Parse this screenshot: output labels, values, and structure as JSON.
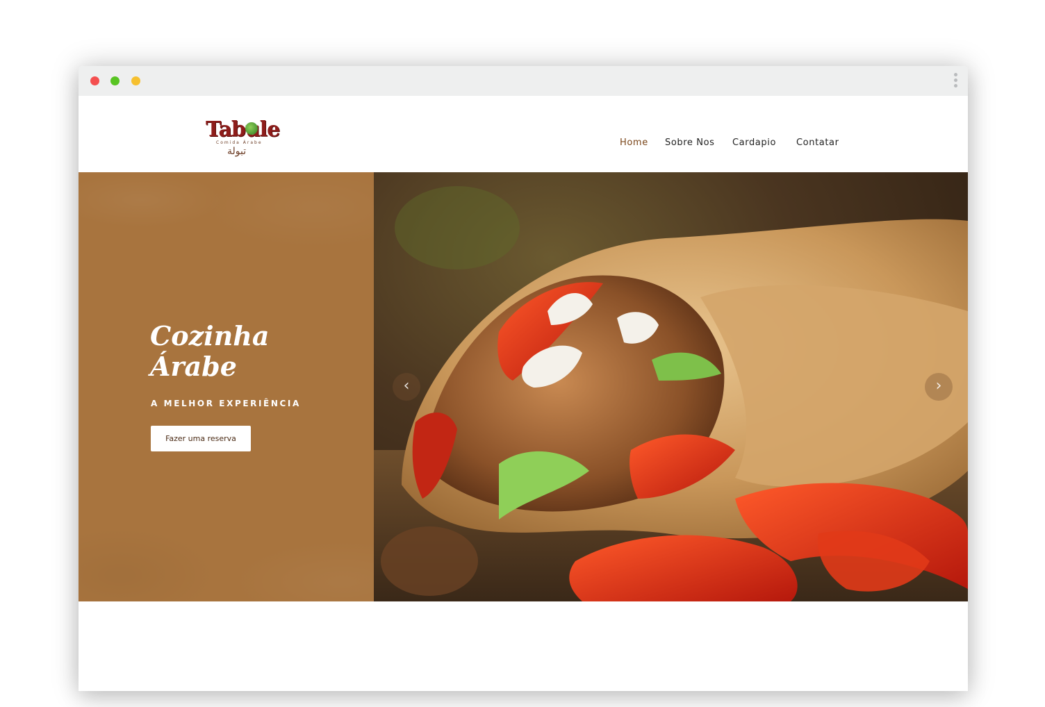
{
  "site": {
    "logo": {
      "word": "Tabule",
      "tagline": "Comida Árabe",
      "arabic": "تبولة"
    },
    "nav": {
      "items": [
        {
          "label": "Home",
          "active": true
        },
        {
          "label": "Sobre Nos",
          "active": false
        },
        {
          "label": "Cardapio",
          "active": false
        },
        {
          "label": "Contatar",
          "active": false
        }
      ]
    }
  },
  "hero": {
    "title": "Cozinha\nÁrabe",
    "subtitle": "A MELHOR EXPERIÊNCIA",
    "button_label": "Fazer uma reserva",
    "prev_icon": "chevron-left-icon",
    "next_icon": "chevron-right-icon",
    "prev_glyph": "‹",
    "next_glyph": "›"
  },
  "colors": {
    "panel": "#a8743e",
    "nav_active": "#7a4518",
    "logo": "#8e1d1b"
  }
}
